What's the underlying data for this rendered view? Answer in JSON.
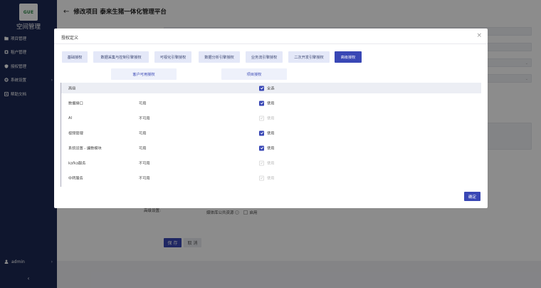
{
  "sidebar": {
    "logo_text": "GUE",
    "app_name": "空间管理",
    "items": [
      {
        "label": "项目管理",
        "icon": "folder-icon",
        "has_chevron": false
      },
      {
        "label": "租户管理",
        "icon": "user-icon",
        "has_chevron": false
      },
      {
        "label": "授权管理",
        "icon": "shield-icon",
        "has_chevron": false
      },
      {
        "label": "系统设置",
        "icon": "gear-icon",
        "has_chevron": true
      },
      {
        "label": "帮助文档",
        "icon": "book-icon",
        "has_chevron": false
      }
    ],
    "user": {
      "name": "admin",
      "icon": "person-icon"
    },
    "collapse_icon": "chevron-left-icon"
  },
  "header": {
    "back_icon": "arrow-left-icon",
    "title": "修改项目 泰来生猪一体化管理平台"
  },
  "form": {
    "advanced_label": "高级设置:",
    "public_resource_label": "媒体库公共资源",
    "public_resource_help_icon": "help-circle-icon",
    "public_resource_option": "启用",
    "save_label": "保 存",
    "cancel_label": "取 消"
  },
  "modal": {
    "title": "授权定义",
    "close_icon": "close-icon",
    "tabs": [
      {
        "label": "基础授权",
        "active": false
      },
      {
        "label": "数据采集与控制引擎授权",
        "active": false
      },
      {
        "label": "可视化引擎授权",
        "active": false
      },
      {
        "label": "数据分析引擎授权",
        "active": false
      },
      {
        "label": "业务流引擎授权",
        "active": false
      },
      {
        "label": "二次开发引擎授权",
        "active": false
      },
      {
        "label": "高级授权",
        "active": true
      }
    ],
    "subtabs": [
      {
        "label": "客户可用授权"
      },
      {
        "label": "项目授权"
      }
    ],
    "table": {
      "header": {
        "name": "高级",
        "check_label": "全选",
        "checked": true
      },
      "rows": [
        {
          "name": "数据接口",
          "status": "可用",
          "checked": true,
          "disabled": false,
          "check_label": "使用"
        },
        {
          "name": "AI",
          "status": "不可用",
          "checked": false,
          "disabled": true,
          "check_label": "使用"
        },
        {
          "name": "视频管理",
          "status": "可用",
          "checked": true,
          "disabled": false,
          "check_label": "使用"
        },
        {
          "name": "系统设置 - 编数模块",
          "status": "可用",
          "checked": true,
          "disabled": false,
          "check_label": "使用"
        },
        {
          "name": "kafka服务",
          "status": "不可用",
          "checked": false,
          "disabled": true,
          "check_label": "使用"
        },
        {
          "name": "中转服务",
          "status": "不可用",
          "checked": false,
          "disabled": true,
          "check_label": "使用"
        }
      ]
    },
    "ok_label": "确定"
  },
  "colors": {
    "sidebar_bg": "#1c2855",
    "primary": "#3947b5",
    "tab_bg": "#e4e8f8"
  }
}
